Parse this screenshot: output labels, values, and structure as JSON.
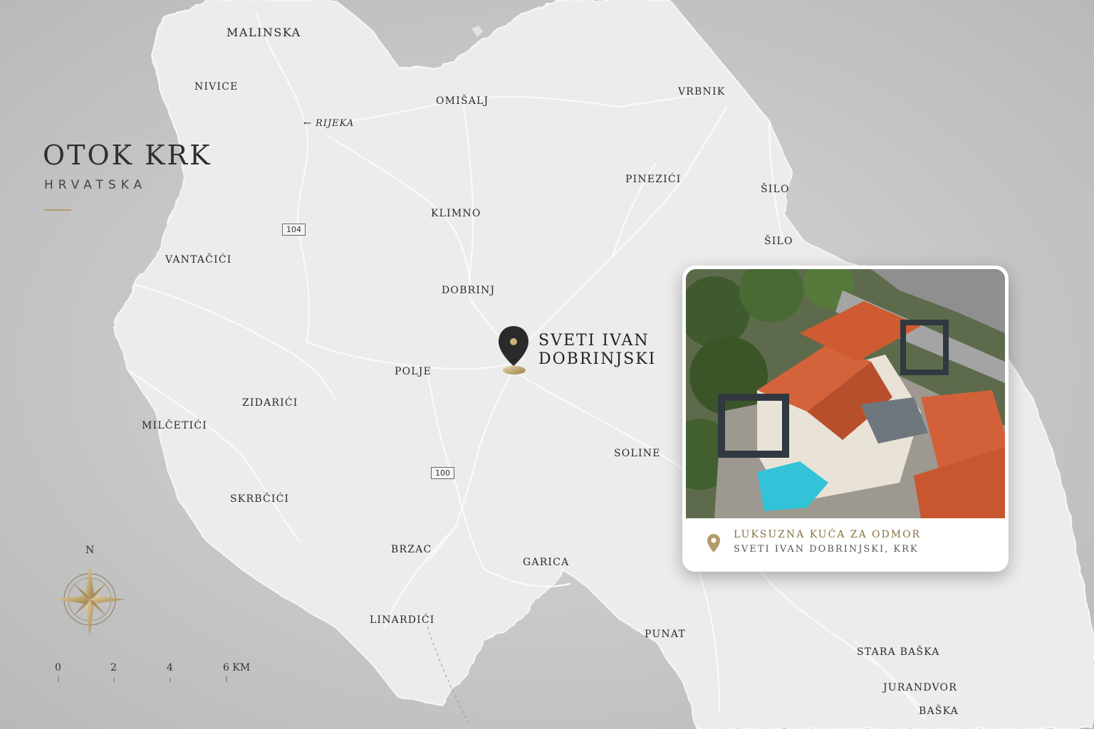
{
  "title": "OTOK KRK",
  "subtitle": "HRVATSKA",
  "places": {
    "malinska": "MALINSKA",
    "nivice": "NIVICE",
    "rijeka": "← RIJEKA",
    "omisalj": "OMIŠALJ",
    "vrbnik": "VRBNIK",
    "pinezici": "PINEZIĆI",
    "silo1": "ŠILO",
    "silo2": "ŠILO",
    "klimno": "KLIMNO",
    "vantacici": "VANTAČIĆI",
    "dobrinj": "DOBRINJ",
    "polje": "POLJE",
    "zidarici": "ZIDARIĆI",
    "milcetici": "MILČETIĆI",
    "soline": "SOLINE",
    "skrbcici": "SKRBČIĆI",
    "brzac": "BRZAC",
    "garica": "GARICA",
    "linardici": "LINARDIĆI",
    "punat": "PUNAT",
    "stara_baska": "STARA BAŠKA",
    "jurandvor": "JURANDVOR",
    "baska": "BAŠKA"
  },
  "roads": {
    "r104": "104",
    "r100": "100"
  },
  "pin": {
    "line1": "SVETI IVAN",
    "line2": "DOBRINJSKI"
  },
  "card": {
    "title": "LUKSUZNA KUĆA ZA ODMOR",
    "subtitle": "SVETI IVAN DOBRINJSKI, KRK"
  },
  "compass": {
    "north": "N"
  },
  "scale": {
    "t0": "0",
    "t2": "2",
    "t4": "4",
    "t6": "6 KM"
  },
  "colors": {
    "accent_gold": "#b39b6b",
    "pin_dark": "#2a2a2a",
    "land": "#ebebeb",
    "sea": "#c6c6c6"
  }
}
